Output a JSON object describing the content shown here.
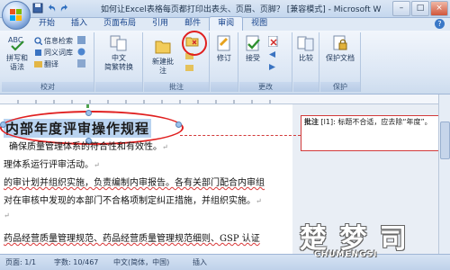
{
  "window": {
    "title": "如何让Excel表格每页都打印出表头、页眉、页脚？ [兼容模式] - Microsoft W",
    "controls": [
      "–",
      "□",
      "×"
    ]
  },
  "ribbon_tabs": [
    "开始",
    "插入",
    "页面布局",
    "引用",
    "邮件",
    "审阅",
    "视图"
  ],
  "active_tab": "审阅",
  "help_label": "?",
  "ribbon": {
    "proofing": {
      "label": "校对",
      "spell_label": "拼写和\n语法",
      "research": "信息检索",
      "thesaurus": "同义词库",
      "translate": "翻译",
      "abc_icon": "ABC"
    },
    "chinese": {
      "label": "中文\n简繁转换"
    },
    "comments": {
      "label": "批注",
      "new_comment": "新建批注"
    },
    "tracking": {
      "label": "修订"
    },
    "changes": {
      "label": "更改",
      "accept": "接受"
    },
    "compare": {
      "label": "比较"
    },
    "protect": {
      "label": "保护",
      "protect_doc": "保护文档"
    }
  },
  "document": {
    "heading": "内部年度评审操作规程",
    "lines": [
      "确保质量管理体系的符合性和有效性。",
      "理体系运行评审活动。",
      "的审计划并组织实施，负责编制内审报告。各有关部门配合内审组",
      "对在审核中发现的本部门不合格项制定纠正措施，并组织实施。",
      "",
      "药品经营质量管理规范、药品经营质量管理规范细则、GSP 认证"
    ],
    "paragraph_mark": "↵"
  },
  "comment": {
    "label": "批注",
    "author_tag": "[l1]:",
    "text": "标题不合适，应去除“年度”。"
  },
  "statusbar": {
    "page": "页面: 1/1",
    "words": "字数: 10/467",
    "language": "中文(简体，中国)",
    "mode": "插入"
  },
  "watermark": {
    "cn": "楚 梦 司",
    "en": "CHUMENGSI"
  }
}
